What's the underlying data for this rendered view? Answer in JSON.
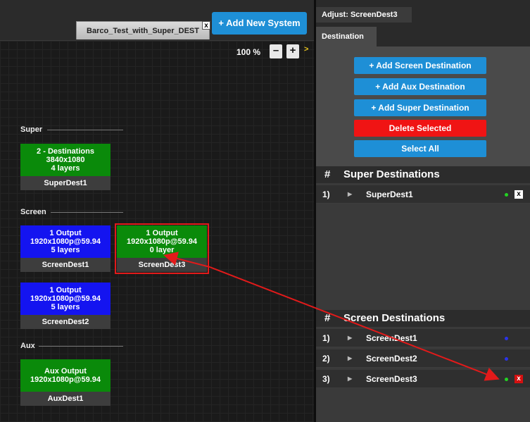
{
  "canvas": {
    "system_tab_label": "Barco_Test_with_Super_DEST",
    "tab_close_glyph": "x",
    "add_system_label": "+ Add New System",
    "zoom_level": "100 %",
    "zoom_out_glyph": "–",
    "zoom_in_glyph": "+",
    "zoom_more_glyph": ">",
    "sections": {
      "super": "Super",
      "screen": "Screen",
      "aux": "Aux"
    },
    "nodes": {
      "superdest1": {
        "line1": "2 - Destinations",
        "line2": "3840x1080",
        "line3": "4 layers",
        "name": "SuperDest1",
        "color": "#0a8a0a"
      },
      "screendest1": {
        "line1": "1 Output",
        "line2": "1920x1080p@59.94",
        "line3": "5 layers",
        "name": "ScreenDest1",
        "color": "#1414f0"
      },
      "screendest3": {
        "line1": "1 Output",
        "line2": "1920x1080p@59.94",
        "line3": "0 layer",
        "name": "ScreenDest3",
        "color": "#0a8a0a"
      },
      "screendest2": {
        "line1": "1 Output",
        "line2": "1920x1080p@59.94",
        "line3": "5 layers",
        "name": "ScreenDest2",
        "color": "#1414f0"
      },
      "auxdest1": {
        "line1": "Aux Output",
        "line2": "1920x1080p@59.94",
        "name": "AuxDest1",
        "color": "#0a8a0a"
      }
    }
  },
  "panel": {
    "title": "Adjust: ScreenDest3",
    "tab": "Destination",
    "buttons": {
      "add_screen": "+ Add Screen Destination",
      "add_aux": "+ Add Aux Destination",
      "add_super": "+ Add Super Destination",
      "delete": "Delete Selected",
      "select_all": "Select All"
    },
    "super_header": {
      "hash": "#",
      "title": "Super Destinations"
    },
    "super_rows": [
      {
        "index": "1)",
        "name": "SuperDest1",
        "status": "green"
      }
    ],
    "screen_header": {
      "hash": "#",
      "title": "Screen Destinations"
    },
    "screen_rows": [
      {
        "index": "1)",
        "name": "ScreenDest1",
        "status": "blue"
      },
      {
        "index": "2)",
        "name": "ScreenDest2",
        "status": "blue"
      },
      {
        "index": "3)",
        "name": "ScreenDest3",
        "status": "green"
      }
    ],
    "caret_glyph": "▶",
    "close_glyph": "x"
  },
  "colors": {
    "accent_blue": "#1e8fd6",
    "delete_red": "#f01414",
    "selection_red": "#e21a1a",
    "node_green": "#0a8a0a",
    "node_blue": "#1414f0"
  }
}
